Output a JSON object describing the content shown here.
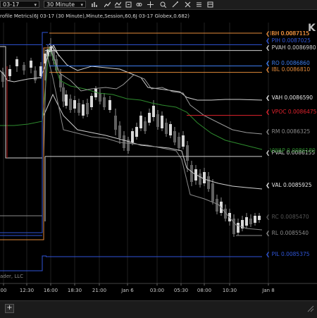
{
  "toolbar": {
    "date_value": "03-17",
    "interval_value": "30 Minute",
    "logo_text": "K"
  },
  "indicator_label": "rofile Metrics(6J 03-17 (30 Minute),Minute,Session,60,6J 03-17 Globex,0.682)",
  "copyright_text": "ader, LLC",
  "x_axis_labels": [
    "00",
    "12:30",
    "16:00",
    "18:30",
    "21:00",
    "Jan 6",
    "03:00",
    "05:30",
    "08:00",
    "10:30",
    "Jan 8"
  ],
  "levels": [
    {
      "label": "RH 0.0087115",
      "color": "#e38a3a"
    },
    {
      "label": "PIH 0.0087025",
      "color": "#2f55d8"
    },
    {
      "label": "PVAH 0.0086980",
      "color": "#cfcfcf"
    },
    {
      "label": "RO 0.0086860",
      "color": "#3d7df0"
    },
    {
      "label": "IBL 0.0086810",
      "color": "#e38a3a"
    },
    {
      "label": "VAH 0.0086590",
      "color": "#e6e6e6"
    },
    {
      "label": "VPOC 0.0086475",
      "color": "#e0222d"
    },
    {
      "label": "RM 0.0086325",
      "color": "#8a8a8a"
    },
    {
      "label": "PVAL 0.0086155",
      "color": "#cfcfcf"
    },
    {
      "label": "VAL 0.0085925",
      "color": "#e6e6e6"
    },
    {
      "label": "RC 0.0085470",
      "color": "#555555"
    },
    {
      "label": "RL 0.0085540",
      "color": "#8a8a8a"
    },
    {
      "label": "PIL 0.0085375",
      "color": "#2f55d8"
    }
  ],
  "overlap_labels": [
    {
      "label": "IBH 0.0087115",
      "color": "#e38a3a"
    },
    {
      "label": "VWAP 0.0086180",
      "color": "#2e8b2e"
    }
  ],
  "colors": {
    "bull_candle": "#d8d8d8",
    "bear_candle": "#606060",
    "wick": "#8c8c8c",
    "vwap": "#2e8b2e",
    "vpoc": "#b01818",
    "grid": "#202020",
    "axis_text": "#c8c8c8"
  }
}
